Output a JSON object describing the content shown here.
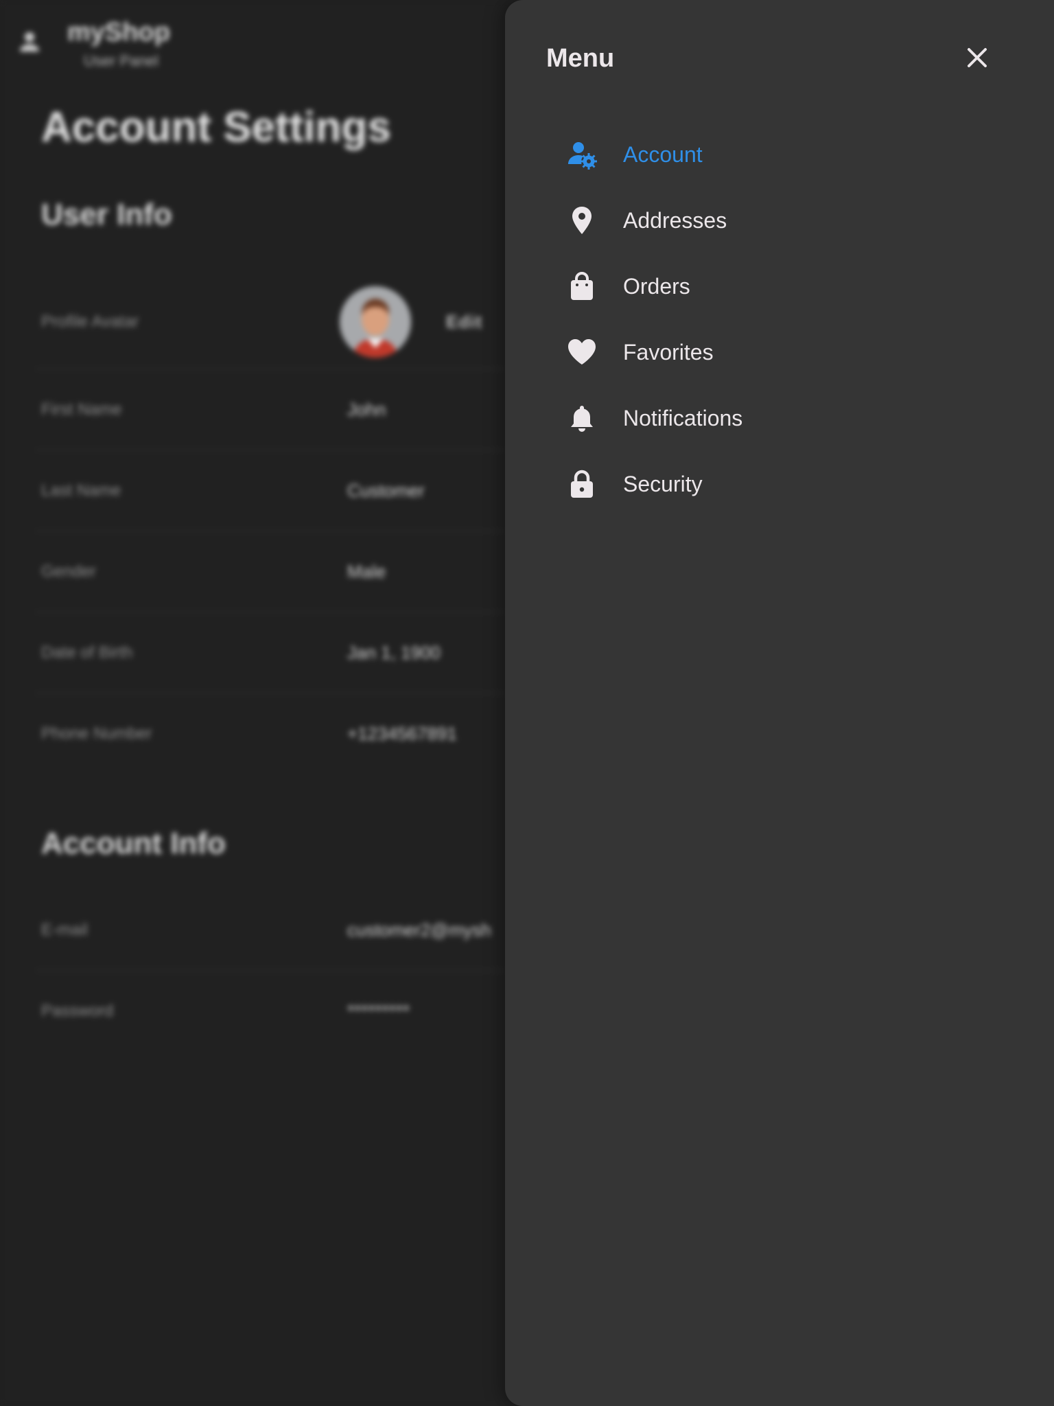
{
  "app": {
    "brand": "myShop",
    "subtitle": "User Panel"
  },
  "page": {
    "title": "Account Settings",
    "user_info": {
      "heading": "User Info",
      "rows": [
        {
          "label": "Profile Avatar",
          "action": "Edit"
        },
        {
          "label": "First Name",
          "value": "John"
        },
        {
          "label": "Last Name",
          "value": "Customer"
        },
        {
          "label": "Gender",
          "value": "Male"
        },
        {
          "label": "Date of Birth",
          "value": "Jan 1, 1900"
        },
        {
          "label": "Phone Number",
          "value": "+1234567891"
        }
      ]
    },
    "account_info": {
      "heading": "Account Info",
      "rows": [
        {
          "label": "E-mail",
          "value": "customer2@mysh"
        },
        {
          "label": "Password",
          "value": "*********"
        }
      ]
    }
  },
  "drawer": {
    "title": "Menu",
    "items": [
      {
        "label": "Account",
        "icon": "account-settings-icon",
        "active": true
      },
      {
        "label": "Addresses",
        "icon": "location-pin-icon",
        "active": false
      },
      {
        "label": "Orders",
        "icon": "shopping-bag-icon",
        "active": false
      },
      {
        "label": "Favorites",
        "icon": "heart-icon",
        "active": false
      },
      {
        "label": "Notifications",
        "icon": "bell-icon",
        "active": false
      },
      {
        "label": "Security",
        "icon": "lock-icon",
        "active": false
      }
    ]
  },
  "colors": {
    "background": "#212121",
    "drawer": "#353535",
    "accent": "#2f8fe8",
    "text": "#ece7ea"
  }
}
